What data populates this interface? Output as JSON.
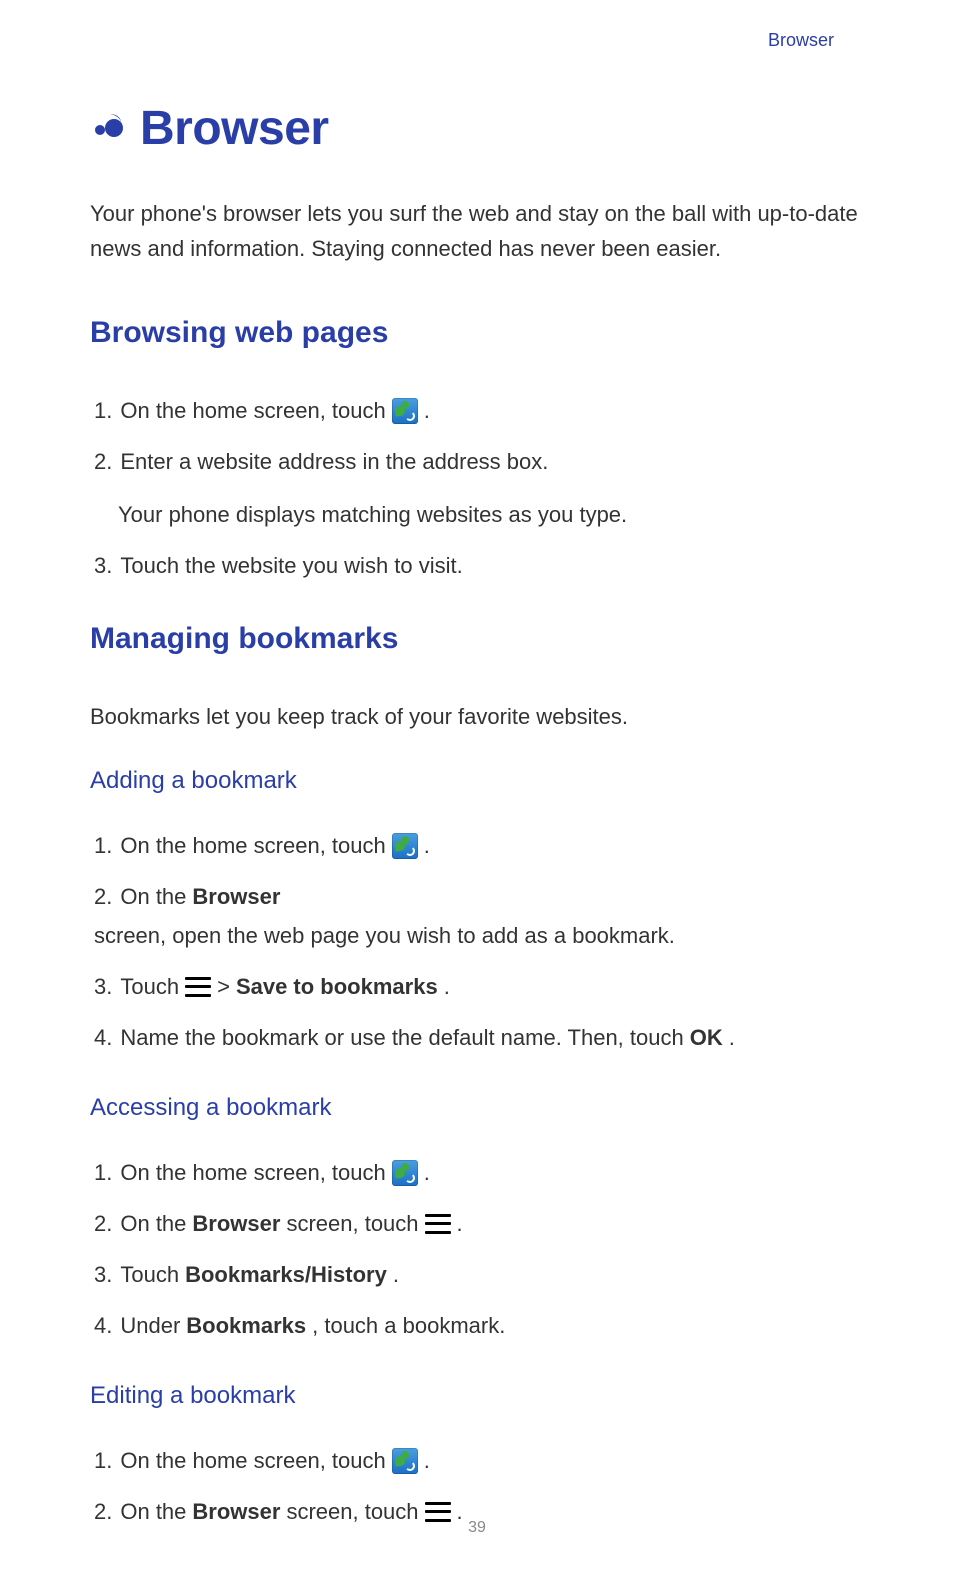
{
  "header": {
    "section_label": "Browser"
  },
  "title": "Browser",
  "intro": "Your phone's browser lets you surf the web and stay on the ball with up-to-date news and information. Staying connected has never been easier.",
  "sections": {
    "browsing": {
      "title": "Browsing web pages",
      "steps": {
        "s1_pre": "On the home screen, touch ",
        "s1_post": ".",
        "s2": "Enter a website address in the address box.",
        "s2_sub": "Your phone displays matching websites as you type.",
        "s3": "Touch the website you wish to visit."
      }
    },
    "managing": {
      "title": "Managing bookmarks",
      "intro": "Bookmarks let you keep track of your favorite websites.",
      "adding": {
        "title": "Adding a bookmark",
        "s1_pre": "On the home screen, touch ",
        "s1_post": ".",
        "s2_pre": "On the ",
        "s2_bold": "Browser",
        "s2_post": " screen, open the web page you wish to add as a bookmark.",
        "s3_pre": "Touch ",
        "s3_mid": " > ",
        "s3_bold": "Save to bookmarks",
        "s3_post": ".",
        "s4_pre": "Name the bookmark or use the default name. Then, touch ",
        "s4_bold": "OK",
        "s4_post": "."
      },
      "accessing": {
        "title": "Accessing a bookmark",
        "s1_pre": "On the home screen, touch ",
        "s1_post": ".",
        "s2_pre": "On the ",
        "s2_bold": "Browser",
        "s2_mid": " screen, touch ",
        "s2_post": ".",
        "s3_pre": "Touch ",
        "s3_bold": "Bookmarks/History",
        "s3_post": ".",
        "s4_pre": "Under ",
        "s4_bold": "Bookmarks",
        "s4_post": ", touch a bookmark."
      },
      "editing": {
        "title": "Editing a bookmark",
        "s1_pre": "On the home screen, touch ",
        "s1_post": ".",
        "s2_pre": "On the ",
        "s2_bold": "Browser",
        "s2_mid": " screen, touch ",
        "s2_post": "."
      }
    }
  },
  "labels": {
    "n1": "1.",
    "n2": "2.",
    "n3": "3.",
    "n4": "4."
  },
  "page_number": "39"
}
